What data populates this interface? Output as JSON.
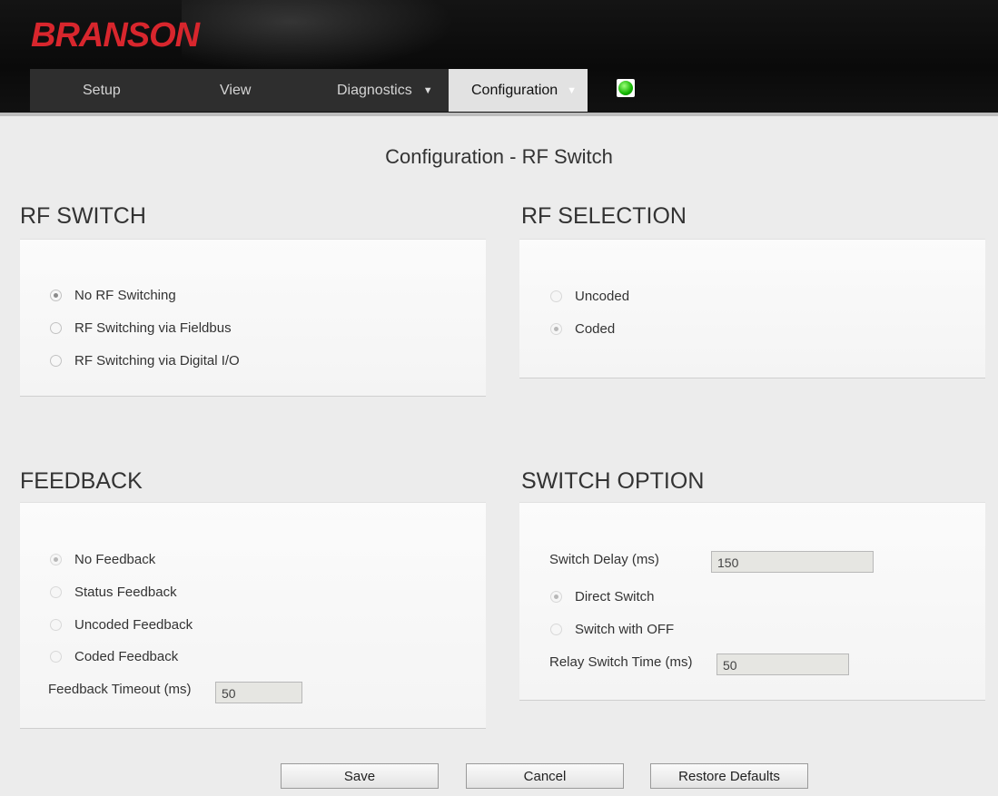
{
  "brand": "BRANSON",
  "nav": {
    "items": [
      {
        "label": "Setup"
      },
      {
        "label": "View"
      },
      {
        "label": "Diagnostics"
      },
      {
        "label": "Configuration"
      }
    ],
    "status_led_color": "#12b400"
  },
  "page_title": "Configuration - RF Switch",
  "rf_switch": {
    "title": "RF SWITCH",
    "options": [
      "No RF Switching",
      "RF Switching via Fieldbus",
      "RF Switching via Digital I/O"
    ],
    "selected": "No RF Switching"
  },
  "rf_selection": {
    "title": "RF SELECTION",
    "options": [
      "Uncoded",
      "Coded"
    ],
    "selected": "Coded"
  },
  "feedback": {
    "title": "FEEDBACK",
    "options": [
      "No Feedback",
      "Status Feedback",
      "Uncoded Feedback",
      "Coded Feedback"
    ],
    "selected": "No Feedback",
    "timeout_label": "Feedback Timeout (ms)",
    "timeout_value": "50"
  },
  "switch_option": {
    "title": "SWITCH OPTION",
    "delay_label": "Switch Delay (ms)",
    "delay_value": "150",
    "options": [
      "Direct Switch",
      "Switch with OFF"
    ],
    "selected": "Direct Switch",
    "relay_label": "Relay Switch Time (ms)",
    "relay_value": "50"
  },
  "buttons": {
    "save": "Save",
    "cancel": "Cancel",
    "restore": "Restore Defaults"
  }
}
